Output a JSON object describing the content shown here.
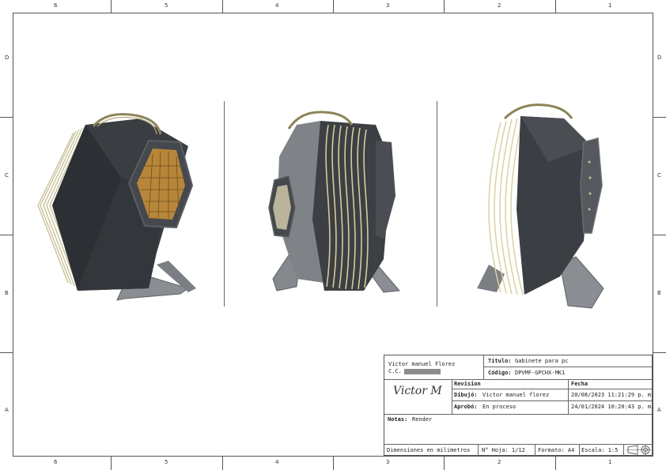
{
  "grid": {
    "columns": [
      "6",
      "5",
      "4",
      "3",
      "2",
      "1"
    ],
    "rows": [
      "D",
      "C",
      "B",
      "A"
    ]
  },
  "renders": [
    {
      "name": "left",
      "body": "#3a3d42",
      "accent": "#b7863a"
    },
    {
      "name": "center",
      "body": "#4a4d52",
      "accent": "#c9c39a"
    },
    {
      "name": "right",
      "body": "#3b3e43",
      "accent": "#d9d1a2"
    }
  ],
  "title_block": {
    "author": "Victor manuel Florez",
    "id_label": "C.C.",
    "titulo_label": "Título:",
    "titulo_value": "Gabinete para pc",
    "codigo_label": "Código:",
    "codigo_value": "DPVMF-GPCHX-MK1",
    "revision_label": "Revision",
    "fecha_label": "Fecha",
    "dibujo_label": "Dibujó:",
    "dibujo_value": "Victor manuel florez",
    "dibujo_fecha": "20/08/2023 11:21:29 p. m.",
    "aprobo_label": "Aprobó:",
    "aprobo_value": "En proceso",
    "aprobo_fecha": "24/01/2024 10:20:43 p. m.",
    "notas_label": "Notas:",
    "notas_value": "Render",
    "dimensiones": "Dimensiones en milimetros",
    "hoja": "N° Hoja: 1/12",
    "formato": "Formato: A4",
    "escala": "Escala: 1:5",
    "signature": "Victor M"
  }
}
